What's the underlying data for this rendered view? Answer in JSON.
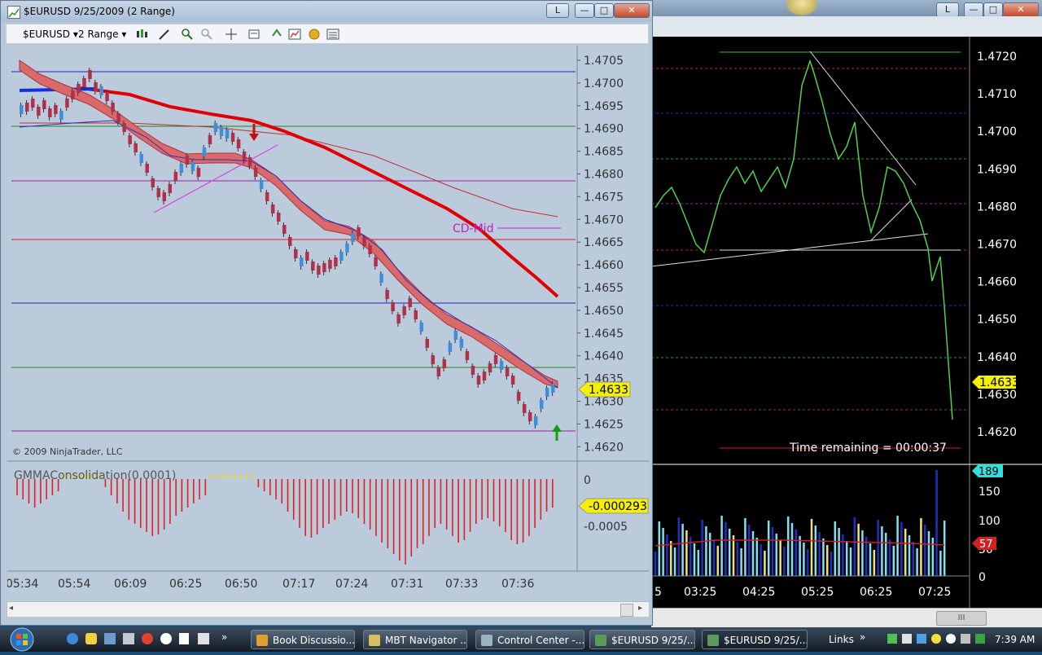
{
  "left_window": {
    "title": "$EURUSD  9/25/2009 (2 Range)",
    "buttons": {
      "lock": "L",
      "minimize": "—",
      "maximize": "□",
      "close": "✕"
    },
    "toolbar": {
      "instrument": "$EURUSD",
      "period": "2 Range"
    },
    "copyright": "© 2009 NinjaTrader, LLC",
    "price_label": "1.4633",
    "cd_label": "CD-Mid",
    "indicator_title": "GMMAConsolidation(0.0001)",
    "indicator_value": "-0.000293",
    "price_ticks": [
      "1.4705",
      "1.4700",
      "1.4695",
      "1.4690",
      "1.4685",
      "1.4680",
      "1.4675",
      "1.4670",
      "1.4665",
      "1.4660",
      "1.4655",
      "1.4650",
      "1.4645",
      "1.4640",
      "1.4635",
      "1.4630",
      "1.4625",
      "1.4620"
    ],
    "indicator_ticks": [
      "0",
      "-0.0005"
    ],
    "time_ticks": [
      "05:34",
      "05:54",
      "06:09",
      "06:25",
      "06:50",
      "07:17",
      "07:24",
      "07:31",
      "07:33",
      "07:36"
    ]
  },
  "right_window": {
    "buttons": {
      "lock": "L",
      "minimize": "—",
      "maximize": "□",
      "close": "✕"
    },
    "price_ticks": [
      "1.4720",
      "1.4710",
      "1.4700",
      "1.4690",
      "1.4680",
      "1.4670",
      "1.4660",
      "1.4650",
      "1.4640",
      "1.4630",
      "1.4620"
    ],
    "price_label": "1.4633",
    "time_remaining": "Time remaining = 00:00:37",
    "volume_ticks": [
      "150",
      "100",
      "50",
      "0"
    ],
    "volume_label": "189",
    "volume_avg_label": "57",
    "time_ticks": [
      "5",
      "03:25",
      "04:25",
      "05:25",
      "06:25",
      "07:25"
    ],
    "scroll_grip": "III"
  },
  "taskbar": {
    "more": "»",
    "tasks": [
      {
        "label": "Book Discussio...",
        "color": "#e0a030"
      },
      {
        "label": "MBT Navigator ...",
        "color": "#d4c060"
      },
      {
        "label": "Control Center -...",
        "color": "#9fb0c0"
      },
      {
        "label": "$EURUSD 9/25/...",
        "color": "#5a9a5a"
      },
      {
        "label": "$EURUSD 9/25/...",
        "color": "#5a9a5a"
      }
    ],
    "links": "Links",
    "links_more": "»",
    "clock": "7:39 AM"
  },
  "colors": {
    "accent_red": "#e00000",
    "band_fill": "#d96a6a",
    "bar_blue": "#3c8fd8",
    "bar_red": "#b0304a",
    "price_yellow": "#f4f000"
  }
}
